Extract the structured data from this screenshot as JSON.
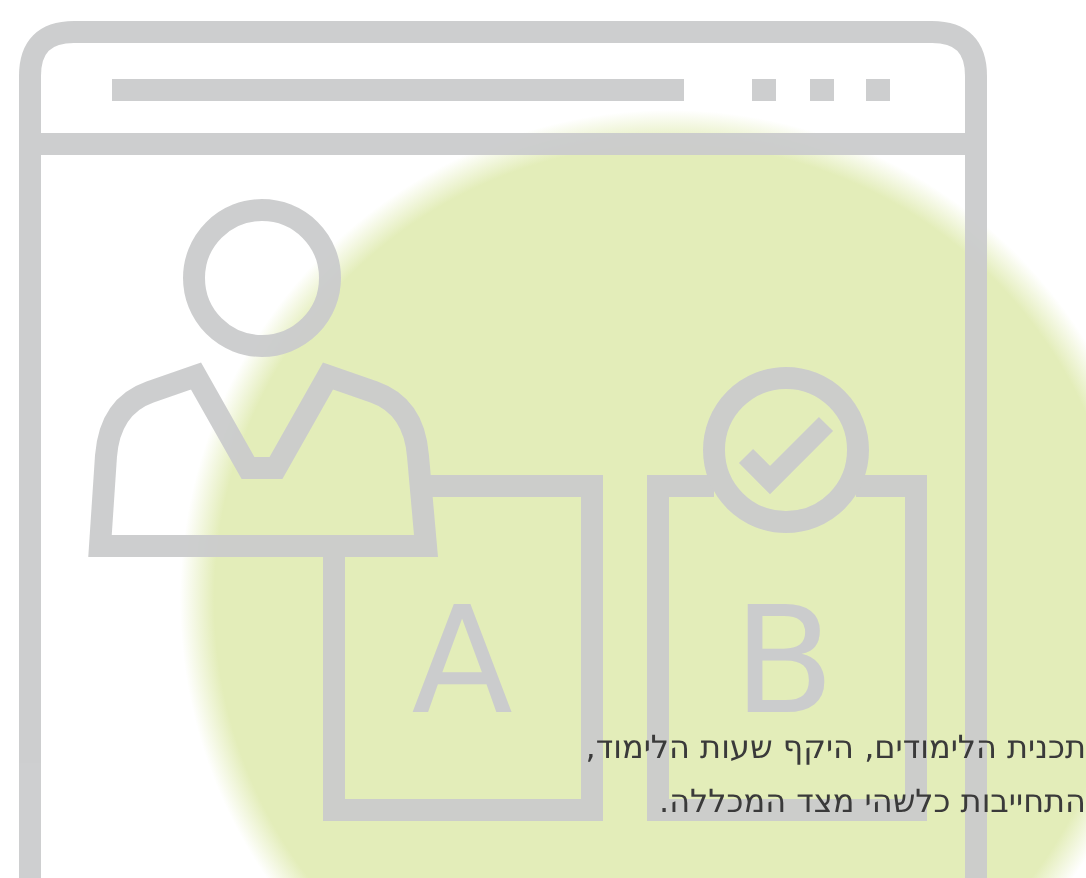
{
  "illustration": {
    "labels": [
      "B",
      "A"
    ]
  },
  "text_lines": [
    "תכנית הלימודים, היקף שעות הלימוד,",
    "התחייבות כלשהי מצד המכללה."
  ]
}
